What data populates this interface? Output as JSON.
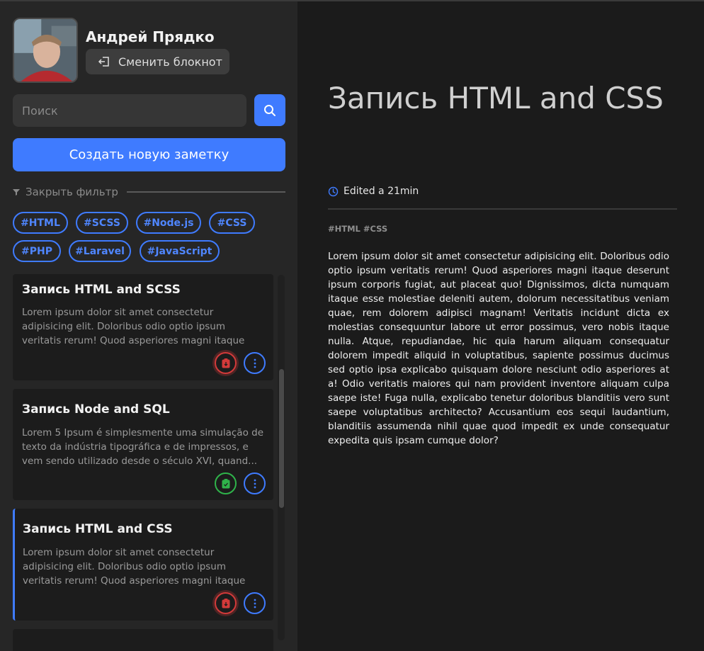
{
  "user": {
    "name": "Андрей Прядко",
    "switch_label": "Сменить блокнот"
  },
  "search": {
    "placeholder": "Поиск"
  },
  "create_label": "Создать новую заметку",
  "filter": {
    "label": "Закрыть фильтр"
  },
  "tags": [
    "#HTML",
    "#SCSS",
    "#Node.js",
    "#CSS",
    "#PHP",
    "#Laravel",
    "#JavaScript"
  ],
  "notes": [
    {
      "title": "Запись HTML and SCSS",
      "text": "Lorem ipsum dolor sit amet consectetur adipisicing elit. Doloribus odio optio ipsum veritatis rerum! Quod asperiores magni itaque deserunt i...",
      "status": "red"
    },
    {
      "title": "Запись Node and SQL",
      "text": "Lorem 5 Ipsum é simplesmente uma simulação de texto da indústria tipográfica e de impressos, e vem sendo utilizado desde o século XVI, quand...",
      "status": "green"
    },
    {
      "title": "Запись HTML and CSS",
      "text": "Lorem ipsum dolor sit amet consectetur adipisicing elit. Doloribus odio optio ipsum veritatis rerum! Quod asperiores magni itaque deserunt i...",
      "status": "red"
    }
  ],
  "main": {
    "title": "Запись HTML and CSS",
    "edited": "Edited a 21min",
    "tags": "#HTML #CSS",
    "body": "Lorem ipsum dolor sit amet consectetur adipisicing elit. Doloribus odio optio ipsum veritatis rerum! Quod asperiores magni itaque deserunt ipsum corporis fugiat, aut placeat quo! Dignissimos, dicta numquam itaque esse molestiae deleniti autem, dolorum necessitatibus veniam quae, rem dolorem adipisci magnam! Veritatis incidunt dicta ex molestias consequuntur labore ut error possimus, vero nobis itaque nulla. Atque, repudiandae, hic quia harum aliquam consequatur dolorem impedit aliquid in voluptatibus, sapiente possimus ducimus sed optio ipsa explicabo quisquam dolore nesciunt odio asperiores at a! Odio veritatis maiores qui nam provident inventore aliquam culpa saepe iste! Fuga nulla, explicabo tenetur doloribus blanditiis vero sunt saepe voluptatibus architecto? Accusantium eos sequi laudantium, blanditiis assumenda nihil quae quod impedit ex unde consequatur expedita quis ipsam cumque dolor?"
  },
  "colors": {
    "accent": "#3f7bff",
    "danger": "#d33a3a",
    "success": "#2fb34a",
    "sidebar_bg": "#262626",
    "main_bg": "#1b1b1b"
  }
}
